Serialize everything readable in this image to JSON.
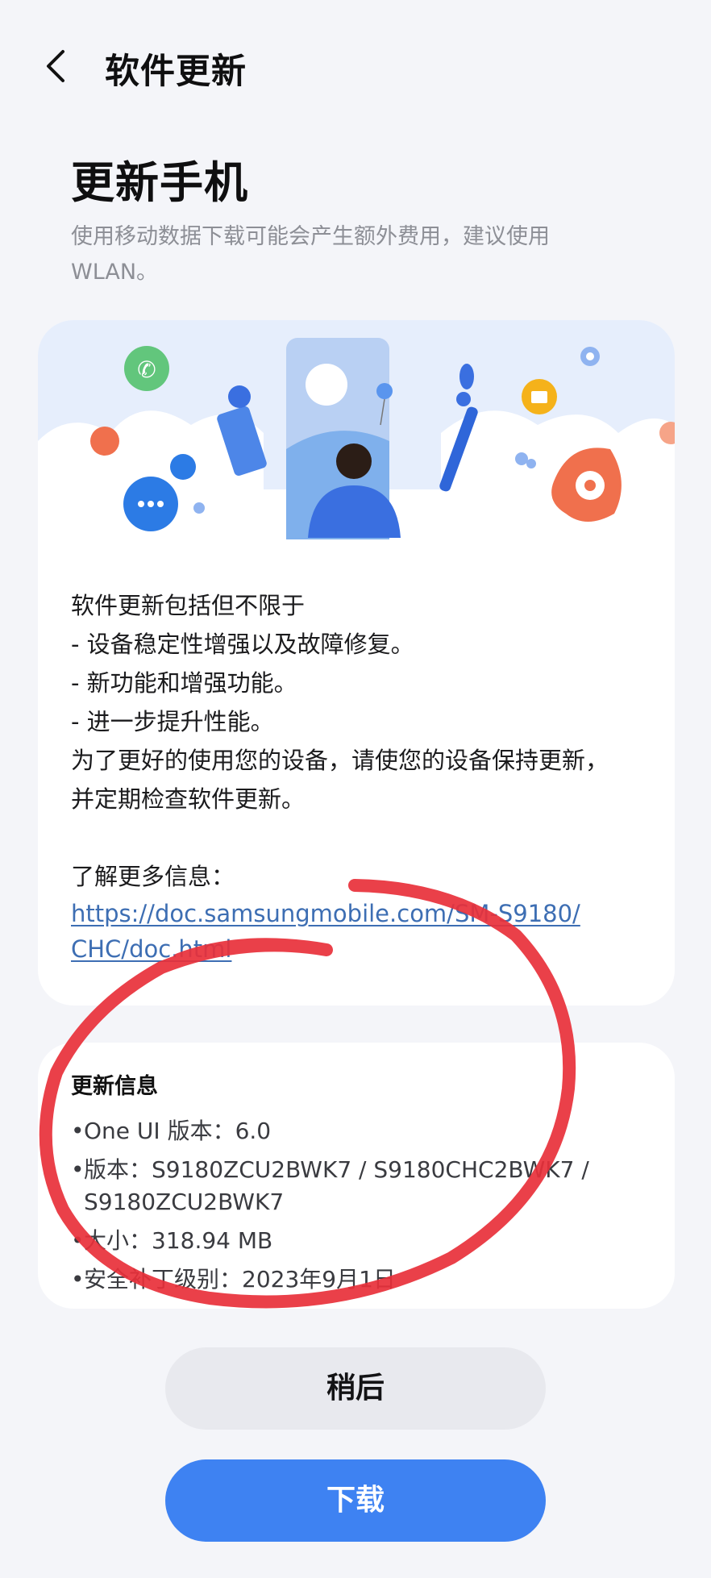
{
  "header": {
    "title": "软件更新"
  },
  "page": {
    "title": "更新手机",
    "subtitle": "使用移动数据下载可能会产生额外费用，建议使用WLAN。"
  },
  "release_notes": {
    "lines": [
      "软件更新包括但不限于",
      "- 设备稳定性增强以及故障修复。",
      "- 新功能和增强功能。",
      "- 进一步提升性能。",
      "为了更好的使用您的设备，请使您的设备保持更新，",
      "并定期检查软件更新。"
    ],
    "more_info_label": "了解更多信息：",
    "link": "https://doc.samsungmobile.com/SM-S9180/CHC/doc.html"
  },
  "update_info": {
    "title": "更新信息",
    "items": [
      {
        "label": "One UI 版本：",
        "value": "6.0"
      },
      {
        "label": "版本：",
        "value": "S9180ZCU2BWK7 / S9180CHC2BWK7 / S9180ZCU2BWK7"
      },
      {
        "label": "大小：",
        "value": "318.94 MB"
      },
      {
        "label": "安全补丁级别：",
        "value": "2023年9月1日"
      }
    ]
  },
  "buttons": {
    "later": "稍后",
    "download": "下载"
  },
  "colors": {
    "accent": "#3e82f2",
    "link": "#3d6eb3",
    "annotation": "#e8303a"
  },
  "icons": {
    "back": "chevron-left-icon"
  }
}
